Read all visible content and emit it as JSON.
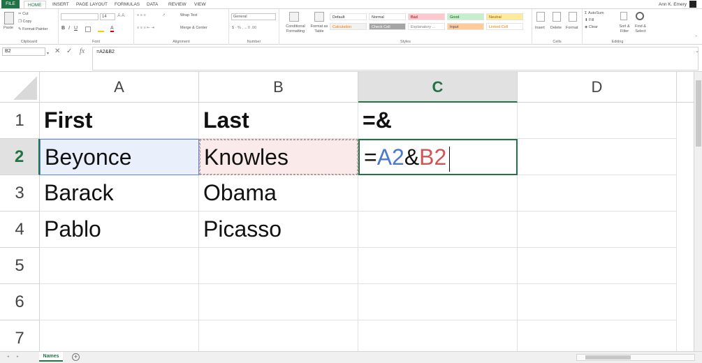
{
  "ribbon_tabs": [
    "FILE",
    "HOME",
    "INSERT",
    "PAGE LAYOUT",
    "FORMULAS",
    "DATA",
    "REVIEW",
    "VIEW"
  ],
  "user": "Ann K. Emery",
  "clipboard": {
    "paste": "Paste",
    "cut": "Cut",
    "copy": "Copy",
    "format_painter": "Format Painter",
    "label": "Clipboard"
  },
  "font": {
    "size": "14",
    "label": "Font"
  },
  "alignment": {
    "wrap": "Wrap Text",
    "merge": "Merge & Center",
    "label": "Alignment"
  },
  "number": {
    "format": "General",
    "label": "Number"
  },
  "styles": {
    "conditional": "Conditional Formatting",
    "format_table": "Format as Table",
    "label": "Styles",
    "cells": [
      {
        "name": "Default",
        "bg": "#ffffff",
        "fg": "#333333"
      },
      {
        "name": "Normal",
        "bg": "#ffffff",
        "fg": "#333333"
      },
      {
        "name": "Bad",
        "bg": "#ffc7ce",
        "fg": "#9c0006"
      },
      {
        "name": "Good",
        "bg": "#c6efce",
        "fg": "#006100"
      },
      {
        "name": "Neutral",
        "bg": "#ffeb9c",
        "fg": "#9c5700"
      },
      {
        "name": "Calculation",
        "bg": "#f2f2f2",
        "fg": "#fa7d00"
      },
      {
        "name": "Check Cell",
        "bg": "#a5a5a5",
        "fg": "#ffffff"
      },
      {
        "name": "Explanatory ...",
        "bg": "#ffffff",
        "fg": "#7f7f7f"
      },
      {
        "name": "Input",
        "bg": "#ffcc99",
        "fg": "#3f3f76"
      },
      {
        "name": "Linked Cell",
        "bg": "#ffffff",
        "fg": "#fa7d00"
      }
    ]
  },
  "cells_group": {
    "insert": "Insert",
    "delete": "Delete",
    "format": "Format",
    "label": "Cells"
  },
  "editing": {
    "autosum": "AutoSum",
    "fill": "Fill",
    "clear": "Clear",
    "sort": "Sort & Filter",
    "find": "Find & Select",
    "label": "Editing"
  },
  "formula_bar": {
    "name_box": "B2",
    "fx": "fx",
    "value": "=A2&B2"
  },
  "columns": [
    "A",
    "B",
    "C",
    "D"
  ],
  "rows": [
    "1",
    "2",
    "3",
    "4",
    "5",
    "6",
    "7"
  ],
  "cells": {
    "A1": "First",
    "B1": "Last",
    "C1": "=&",
    "A2": "Beyonce",
    "B2": "Knowles",
    "A3": "Barack",
    "B3": "Obama",
    "A4": "Pablo",
    "B4": "Picasso"
  },
  "edit_cell": {
    "prefix": "=",
    "ref_a": "A2",
    "amp": "&",
    "ref_b": "B2"
  },
  "sheet_tab": "Names",
  "colors": {
    "accent": "#217346",
    "ref_a": "#4a78d0",
    "ref_b": "#d25555"
  }
}
